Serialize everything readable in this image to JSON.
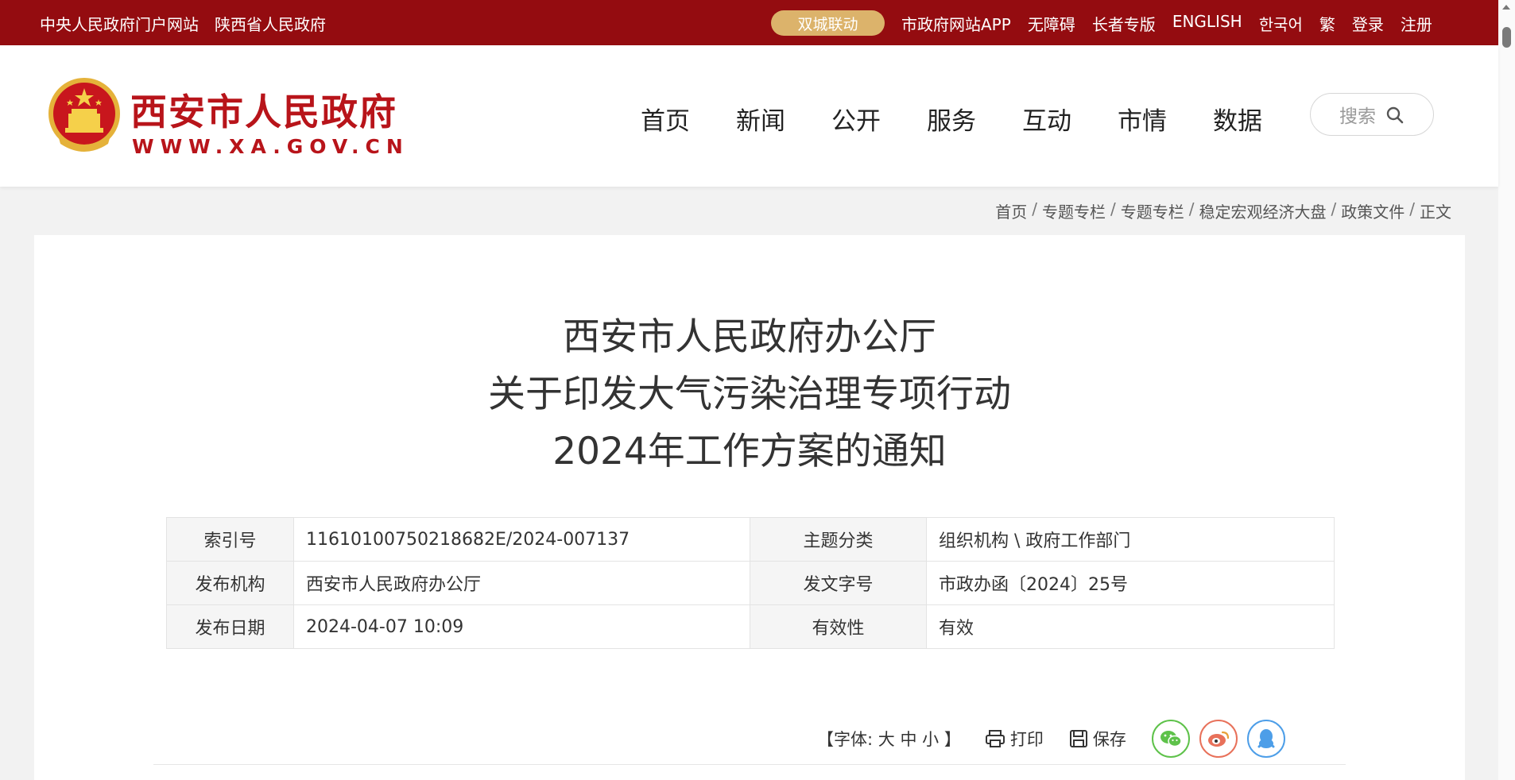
{
  "topbar": {
    "left_links": [
      "中央人民政府门户网站",
      "陕西省人民政府"
    ],
    "twin_city_button": "双城联动",
    "right_links": [
      "市政府网站APP",
      "无障碍",
      "长者专版",
      "ENGLISH",
      "한국어",
      "繁",
      "登录",
      "注册"
    ],
    "color": "#940c10"
  },
  "header": {
    "site_name": "西安市人民政府",
    "site_url": "WWW.XA.GOV.CN",
    "nav": [
      "首页",
      "新闻",
      "公开",
      "服务",
      "互动",
      "市情",
      "数据"
    ],
    "search_placeholder": "搜索"
  },
  "breadcrumb": [
    "首页",
    "专题专栏",
    "专题专栏",
    "稳定宏观经济大盘",
    "政策文件",
    "正文"
  ],
  "article": {
    "title_lines": [
      "西安市人民政府办公厅",
      "关于印发大气污染治理专项行动",
      "2024年工作方案的通知"
    ],
    "meta": {
      "index_label": "索引号",
      "index_value": "11610100750218682E/2024-007137",
      "topic_label": "主题分类",
      "topic_value": "组织机构 \\ 政府工作部门",
      "publisher_label": "发布机构",
      "publisher_value": "西安市人民政府办公厅",
      "doc_no_label": "发文字号",
      "doc_no_value": "市政办函〔2024〕25号",
      "date_label": "发布日期",
      "date_value": "2024-04-07 10:09",
      "validity_label": "有效性",
      "validity_value": "有效"
    }
  },
  "tools": {
    "font_prefix": "【字体:",
    "font_large": "大",
    "font_medium": "中",
    "font_small": "小",
    "font_suffix": "】",
    "print": "打印",
    "save": "保存",
    "share_icons": [
      "wechat-icon",
      "weibo-icon",
      "qq-icon"
    ]
  }
}
